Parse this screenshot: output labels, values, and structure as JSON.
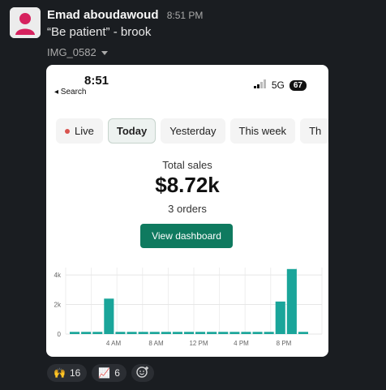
{
  "message": {
    "author": "Emad aboudawoud",
    "time": "8:51 PM",
    "text": "“Be patient” - brook",
    "file_label": "IMG_0582"
  },
  "phone": {
    "time": "8:51",
    "back": "◂ Search",
    "network": "5G",
    "battery": "67"
  },
  "dashboard": {
    "tabs": [
      {
        "label": "Live"
      },
      {
        "label": "Today"
      },
      {
        "label": "Yesterday"
      },
      {
        "label": "This week"
      },
      {
        "label": "Th"
      }
    ],
    "total_sales_label": "Total sales",
    "total_sales_value": "$8.72k",
    "orders_text": "3 orders",
    "view_button": "View dashboard",
    "accent_color": "#0f7a5f"
  },
  "chart_data": {
    "type": "bar",
    "x_tick_labels": [
      "4 AM",
      "8 AM",
      "12 PM",
      "4 PM",
      "8 PM"
    ],
    "y_tick_labels": [
      "4k",
      "2k",
      "0"
    ],
    "ylim": [
      0,
      4500
    ],
    "values": [
      150,
      150,
      150,
      2400,
      150,
      150,
      150,
      150,
      150,
      150,
      150,
      150,
      150,
      150,
      150,
      150,
      150,
      150,
      2200,
      4400,
      150
    ]
  },
  "reactions": [
    {
      "emoji": "🙌",
      "count": "16"
    },
    {
      "emoji": "📈",
      "count": "6"
    }
  ]
}
